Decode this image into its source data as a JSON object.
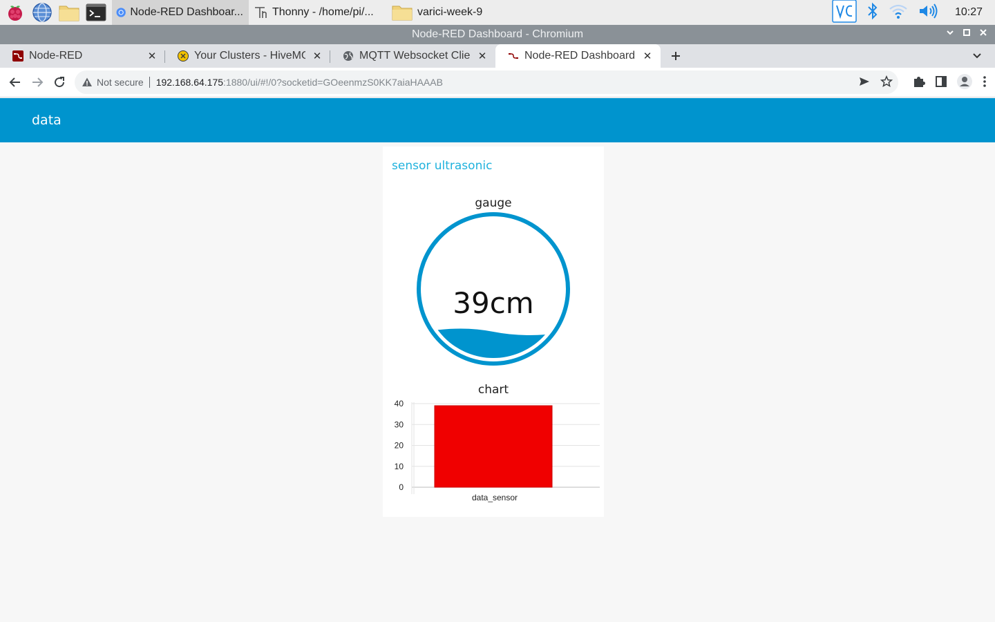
{
  "taskbar": {
    "tasks": [
      {
        "label": "Node-RED Dashboar..."
      },
      {
        "label": "Thonny  -  /home/pi/..."
      },
      {
        "label": "varici-week-9"
      }
    ],
    "clock": "10:27"
  },
  "window": {
    "title": "Node-RED Dashboard - Chromium"
  },
  "browser": {
    "tabs": [
      {
        "title": "Node-RED"
      },
      {
        "title": "Your Clusters - HiveMQ Cloud"
      },
      {
        "title": "MQTT Websocket Client"
      },
      {
        "title": "Node-RED Dashboard"
      }
    ],
    "omnibox": {
      "security_label": "Not secure",
      "url_host": "192.168.64.175",
      "url_rest": ":1880/ui/#!/0?socketid=GOeenmzS0KK7aiaHAAAB"
    }
  },
  "colors": {
    "header": "#0094ce",
    "group_title": "#20b2dd",
    "gauge": "#0094ce",
    "bar": "#f00000"
  },
  "dashboard": {
    "header_title": "data",
    "group": {
      "title": "sensor ultrasonic",
      "gauge": {
        "label": "gauge",
        "value_text": "39cm",
        "level_fraction": 0.2
      },
      "chart": {
        "label": "chart"
      }
    }
  },
  "chart_data": {
    "type": "bar",
    "categories": [
      "data_sensor"
    ],
    "values": [
      39
    ],
    "ylim": [
      0,
      40
    ],
    "yticks": [
      0,
      10,
      20,
      30,
      40
    ],
    "grid": true,
    "bar_color": "#f00000"
  }
}
